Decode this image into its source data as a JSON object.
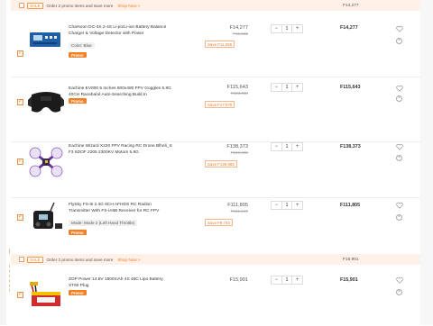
{
  "promo_groups": [
    {
      "sale_label": "SALE",
      "text": "Order 2 promo items and save more",
      "shop_now": "Shop Now >",
      "total": "F14,277"
    },
    {
      "sale_label": "SALE",
      "text": "Order 2 promo items and save more",
      "shop_now": "Shop Now >",
      "total": "F15,901"
    }
  ],
  "items": [
    {
      "title": "Charsoon DC-4S 2-4S Li-po/Li-ion Battery Balance Charger & Voltage Detector with Power",
      "variant": "Color: Blue",
      "badge": "Promo",
      "price": "F14,277",
      "original_price": "F15,532",
      "save": "Save F11,255",
      "quantity": "1",
      "subtotal": "F14,277",
      "minus": "−",
      "plus": "+"
    },
    {
      "title": "Eachine EV800 5 Inches 800x480 FPV Goggles 5.8G 40CH Raceband Auto-Searching Build In",
      "variant": "",
      "badge": "Promo",
      "price": "F115,643",
      "original_price": "F123,318",
      "save": "Save F17,575",
      "quantity": "1",
      "subtotal": "F115,643",
      "minus": "−",
      "plus": "+"
    },
    {
      "title": "Eachine Wizard X220 FPV Racing RC Drone Blheli_S F3 6DOF 2205 2300KV Motors 5.8G",
      "variant": "",
      "badge": "Promo",
      "price": "F138,373",
      "original_price": "F150,838",
      "save": "Save F129,665",
      "quantity": "1",
      "subtotal": "F138,373",
      "minus": "−",
      "plus": "+"
    },
    {
      "title": "FlySky FS-i6 2.4G 6CH AFHDS RC Radion Transmitter With FS-iA6B Receiver for RC FPV",
      "variant": "Mode: Mode 2 (Left Hand Throttle)",
      "badge": "Promo",
      "price": "F111,805",
      "original_price": "F121,547",
      "save": "Save F9,742",
      "quantity": "1",
      "subtotal": "F111,805",
      "minus": "−",
      "plus": "+"
    },
    {
      "title": "ZOP Power 14.8V 1500mAh 4S 45C Lipo Battery XT60 Plug",
      "variant": "",
      "badge": "Promo",
      "price": "F15,901",
      "original_price": "",
      "save": "",
      "quantity": "1",
      "subtotal": "F15,901",
      "minus": "−",
      "plus": "+"
    }
  ],
  "icons": {
    "check": "✓",
    "heart": "heart-icon",
    "delete": "×"
  },
  "colors": {
    "accent": "#f57f26",
    "promo_bg": "#fff1e8"
  }
}
